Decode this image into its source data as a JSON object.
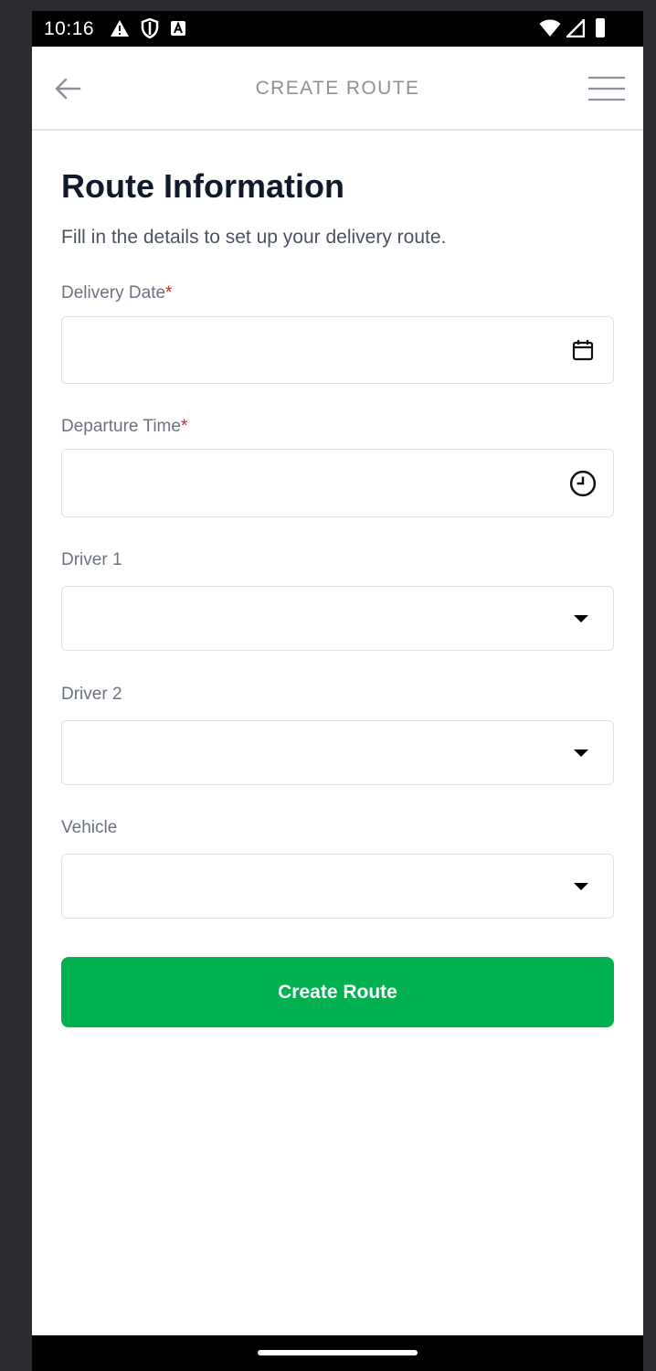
{
  "status_bar": {
    "time": "10:16"
  },
  "header": {
    "title": "CREATE ROUTE"
  },
  "form": {
    "title": "Route Information",
    "subtitle": "Fill in the details to set up your delivery route.",
    "fields": [
      {
        "label": "Delivery Date",
        "required_mark": "*",
        "value": "",
        "icon": "calendar-icon"
      },
      {
        "label": "Departure Time",
        "required_mark": "*",
        "value": "",
        "icon": "clock-icon"
      },
      {
        "label": "Driver 1",
        "value": "",
        "icon": "dropdown-caret-icon"
      },
      {
        "label": "Driver 2",
        "value": "",
        "icon": "dropdown-caret-icon"
      },
      {
        "label": "Vehicle",
        "value": "",
        "icon": "dropdown-caret-icon"
      }
    ],
    "submit_label": "Create Route"
  },
  "colors": {
    "primary_button": "#01b150",
    "required": "#e01b1b",
    "title_text": "#111a2b"
  }
}
